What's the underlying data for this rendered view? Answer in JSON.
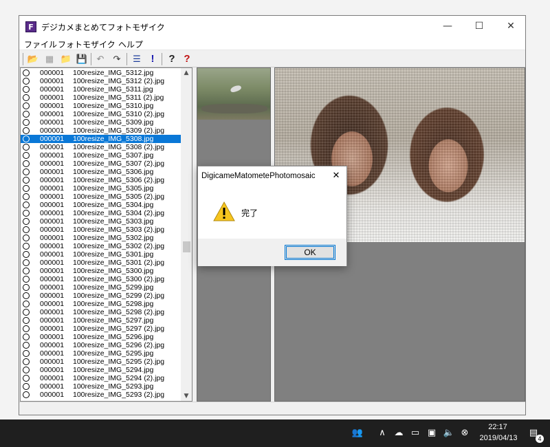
{
  "window": {
    "title": "デジカメまとめてフォトモザイク",
    "app_icon_letter": "F",
    "minimize": "—",
    "maximize": "☐",
    "close": "✕"
  },
  "menu": [
    {
      "label": "ファイル"
    },
    {
      "label": "フォトモザイク"
    },
    {
      "label": "ヘルプ"
    }
  ],
  "toolbar": [
    {
      "icon": "open-folder-icon",
      "glyph": "📂"
    },
    {
      "icon": "new-image-icon",
      "glyph": "▦"
    },
    {
      "icon": "folder-icon",
      "glyph": "📁"
    },
    {
      "icon": "save-icon",
      "glyph": "💾"
    },
    {
      "icon": "undo-icon",
      "glyph": "↶"
    },
    {
      "icon": "redo-icon",
      "glyph": "↷"
    },
    {
      "icon": "list-icon",
      "glyph": "☰"
    },
    {
      "icon": "exclamation-icon",
      "glyph": "!"
    },
    {
      "icon": "help-icon",
      "glyph": "?"
    },
    {
      "icon": "help-red-icon",
      "glyph": "?"
    }
  ],
  "files": [
    {
      "num": "000001",
      "name": "100resize_IMG_5312.jpg"
    },
    {
      "num": "000001",
      "name": "100resize_IMG_5312 (2).jpg"
    },
    {
      "num": "000001",
      "name": "100resize_IMG_5311.jpg"
    },
    {
      "num": "000001",
      "name": "100resize_IMG_5311 (2).jpg"
    },
    {
      "num": "000001",
      "name": "100resize_IMG_5310.jpg"
    },
    {
      "num": "000001",
      "name": "100resize_IMG_5310 (2).jpg"
    },
    {
      "num": "000001",
      "name": "100resize_IMG_5309.jpg"
    },
    {
      "num": "000001",
      "name": "100resize_IMG_5309 (2).jpg"
    },
    {
      "num": "000001",
      "name": "100resize_IMG_5308.jpg",
      "selected": true
    },
    {
      "num": "000001",
      "name": "100resize_IMG_5308 (2).jpg"
    },
    {
      "num": "000001",
      "name": "100resize_IMG_5307.jpg"
    },
    {
      "num": "000001",
      "name": "100resize_IMG_5307 (2).jpg"
    },
    {
      "num": "000001",
      "name": "100resize_IMG_5306.jpg"
    },
    {
      "num": "000001",
      "name": "100resize_IMG_5306 (2).jpg"
    },
    {
      "num": "000001",
      "name": "100resize_IMG_5305.jpg"
    },
    {
      "num": "000001",
      "name": "100resize_IMG_5305 (2).jpg"
    },
    {
      "num": "000001",
      "name": "100resize_IMG_5304.jpg"
    },
    {
      "num": "000001",
      "name": "100resize_IMG_5304 (2).jpg"
    },
    {
      "num": "000001",
      "name": "100resize_IMG_5303.jpg"
    },
    {
      "num": "000001",
      "name": "100resize_IMG_5303 (2).jpg"
    },
    {
      "num": "000001",
      "name": "100resize_IMG_5302.jpg"
    },
    {
      "num": "000001",
      "name": "100resize_IMG_5302 (2).jpg"
    },
    {
      "num": "000001",
      "name": "100resize_IMG_5301.jpg"
    },
    {
      "num": "000001",
      "name": "100resize_IMG_5301 (2).jpg"
    },
    {
      "num": "000001",
      "name": "100resize_IMG_5300.jpg"
    },
    {
      "num": "000001",
      "name": "100resize_IMG_5300 (2).jpg"
    },
    {
      "num": "000001",
      "name": "100resize_IMG_5299.jpg"
    },
    {
      "num": "000001",
      "name": "100resize_IMG_5299 (2).jpg"
    },
    {
      "num": "000001",
      "name": "100resize_IMG_5298.jpg"
    },
    {
      "num": "000001",
      "name": "100resize_IMG_5298 (2).jpg"
    },
    {
      "num": "000001",
      "name": "100resize_IMG_5297.jpg"
    },
    {
      "num": "000001",
      "name": "100resize_IMG_5297 (2).jpg"
    },
    {
      "num": "000001",
      "name": "100resize_IMG_5296.jpg"
    },
    {
      "num": "000001",
      "name": "100resize_IMG_5296 (2).jpg"
    },
    {
      "num": "000001",
      "name": "100resize_IMG_5295.jpg"
    },
    {
      "num": "000001",
      "name": "100resize_IMG_5295 (2).jpg"
    },
    {
      "num": "000001",
      "name": "100resize_IMG_5294.jpg"
    },
    {
      "num": "000001",
      "name": "100resize_IMG_5294 (2).jpg"
    },
    {
      "num": "000001",
      "name": "100resize_IMG_5293.jpg"
    },
    {
      "num": "000001",
      "name": "100resize_IMG_5293 (2).jpg"
    }
  ],
  "scroll": {
    "up": "▲",
    "down": "▼"
  },
  "dialog": {
    "title": "DigicameMatometePhotomosaic",
    "close": "✕",
    "message": "完了",
    "ok_label": "OK"
  },
  "taskbar": {
    "time": "22:17",
    "date": "2019/04/13",
    "notification_count": "4",
    "tray": [
      {
        "icon": "people-icon",
        "glyph": "👥"
      },
      {
        "icon": "chevron-up-icon",
        "glyph": "∧"
      },
      {
        "icon": "onedrive-icon",
        "glyph": "☁"
      },
      {
        "icon": "battery-icon",
        "glyph": "▭"
      },
      {
        "icon": "network-icon",
        "glyph": "▣"
      },
      {
        "icon": "volume-icon",
        "glyph": "🔈"
      },
      {
        "icon": "close-circle-icon",
        "glyph": "⊗"
      },
      {
        "icon": "notification-icon",
        "glyph": "▤"
      }
    ]
  },
  "colors": {
    "selection": "#0a78d7",
    "panel_gray": "#808080",
    "taskbar": "#1f1f1f",
    "accent": "#0078d7"
  }
}
